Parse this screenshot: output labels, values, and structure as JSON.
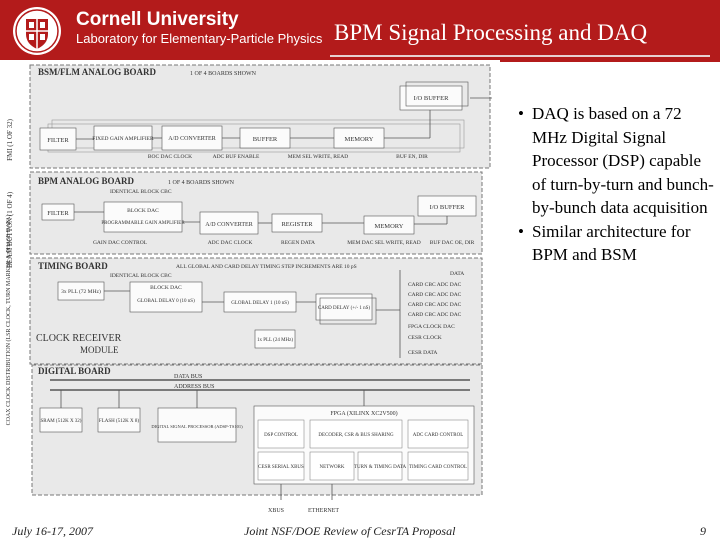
{
  "header": {
    "university": "Cornell University",
    "laboratory": "Laboratory for Elementary-Particle Physics",
    "slide_title": "BPM Signal Processing and DAQ"
  },
  "diagram": {
    "side_labels": [
      "FMI (1 OF 32)",
      "BEAM BUTTON (1 OF 4)",
      "COAX CLOCK DISTRIBUTION (LSR CLOCK, TURN MARKER & PHASE DATA)"
    ],
    "bsm_board": {
      "title": "BSM/FLM ANALOG BOARD",
      "subtitle": "1 OF 4 BOARDS SHOWN",
      "blocks": [
        "FILTER",
        "FIXED GAIN AMPLIFIER",
        "A/D CONVERTER",
        "BUFFER",
        "MEMORY",
        "I/O BUFFER"
      ],
      "signals": [
        "BOC DAC CLOCK",
        "ADC BUF ENABLE",
        "MEM SEL WRITE, READ",
        "BUF EN, DIR"
      ]
    },
    "bpm_board": {
      "title": "BPM ANALOG BOARD",
      "subtitle": "1 OF 4 BOARDS SHOWN",
      "identical": "IDENTICAL BLOCK CBC",
      "blocks": [
        "FILTER",
        "BLOCK DAC",
        "PROGRAMMABLE GAIN AMPLIFIER",
        "A/D CONVERTER",
        "REGISTER",
        "MEMORY",
        "I/O BUFFER"
      ],
      "signals": [
        "GAIN DAC CONTROL",
        "ADC DAC CLOCK",
        "REGEN DATA",
        "MEM DAC SEL WRITE, READ",
        "BUF DAC OE, DIR"
      ]
    },
    "timing_board": {
      "title": "TIMING BOARD",
      "note": "ALL GLOBAL AND CARD DELAY TIMING STEP INCREMENTS ARE 10 pS",
      "identical": "IDENTICAL BLOCK CBC",
      "blocks": [
        "3x PLL (72 MHz)",
        "BLOCK DAC",
        "GLOBAL DELAY 0 (10 nS)",
        "GLOBAL DELAY 1 (10 nS)",
        "CARD DELAY (+/- 1 nS)",
        "1x PLL (24 MHz)"
      ],
      "outputs": [
        "DATA",
        "CARD CBC ADC DAC",
        "CARD CBC ADC DAC",
        "CARD CBC ADC DAC",
        "CARD CBC ADC DAC",
        "FPGA CLOCK DAC",
        "CESR CLOCK",
        "CESR DATA"
      ]
    },
    "clock_receiver": {
      "line1": "CLOCK RECEIVER",
      "line2": "MODULE"
    },
    "digital_board": {
      "title": "DIGITAL BOARD",
      "buses": [
        "DATA BUS",
        "ADDRESS BUS"
      ],
      "sram": "SRAM (512K X 32)",
      "flash": "FLASH (512K X 8)",
      "dsp": "DIGITAL SIGNAL PROCESSOR (ADSP-TS101)",
      "fpga": "FPGA (XILINX XC2V500)",
      "fpga_cells": [
        "DSP CONTROL",
        "DECODER, CSR & BUS SHARING",
        "ADC CARD CONTROL",
        "CESR SERIAL XBUS",
        "NETWORK",
        "TURN & TIMING DATA",
        "TIMING CARD CONTROL"
      ],
      "ports": [
        "XBUS",
        "ETHERNET"
      ]
    }
  },
  "bullets": [
    {
      "dot": "•",
      "text": "DAQ is based on a 72 MHz Digital Signal Processor (DSP) capable of turn-by-turn and bunch-by-bunch data acquisition"
    },
    {
      "dot": "•",
      "text": "Similar architecture for BPM and BSM"
    }
  ],
  "footer": {
    "date": "July 16-17, 2007",
    "event": "Joint NSF/DOE Review of CesrTA Proposal",
    "page": "9"
  }
}
